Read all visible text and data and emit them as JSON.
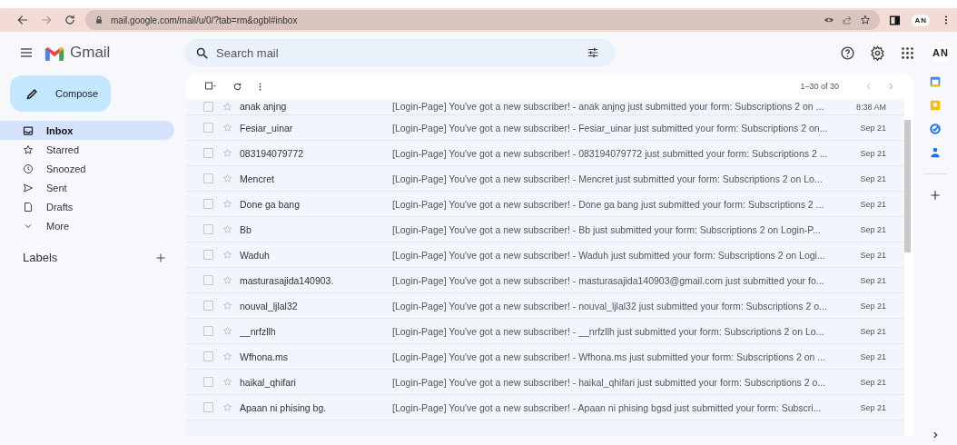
{
  "browser": {
    "url": "mail.google.com/mail/u/0/?tab=rm&ogbl#inbox",
    "profile": "AN"
  },
  "app": {
    "name": "Gmail",
    "search_placeholder": "Search mail",
    "account": "AN"
  },
  "compose": "Compose",
  "nav": [
    {
      "label": "Inbox",
      "kind": "inbox",
      "selected": true
    },
    {
      "label": "Starred",
      "kind": "star",
      "selected": false
    },
    {
      "label": "Snoozed",
      "kind": "clock",
      "selected": false
    },
    {
      "label": "Sent",
      "kind": "send",
      "selected": false
    },
    {
      "label": "Drafts",
      "kind": "file",
      "selected": false
    },
    {
      "label": "More",
      "kind": "chevron",
      "selected": false
    }
  ],
  "labels_heading": "Labels",
  "pagination": "1–30 of 30",
  "emails": [
    {
      "sender": "anak anjng",
      "text": "[Login-Page] You've got a new subscriber! - anak anjng just submitted your form: Subscriptions 2 on ...",
      "date": "8:38 AM",
      "checked": false,
      "starred": false
    },
    {
      "sender": "Fesiar_uinar",
      "text": "[Login-Page] You've got a new subscriber! - Fesiar_uinar just submitted your form: Subscriptions 2 on...",
      "date": "Sep 21",
      "checked": false,
      "starred": false
    },
    {
      "sender": "083194079772",
      "text": "[Login-Page] You've got a new subscriber! - 083194079772 just submitted your form: Subscriptions 2 ...",
      "date": "Sep 21",
      "checked": false,
      "starred": false
    },
    {
      "sender": "Mencret",
      "text": "[Login-Page] You've got a new subscriber! - Mencret just submitted your form: Subscriptions 2 on Lo...",
      "date": "Sep 21",
      "checked": false,
      "starred": false
    },
    {
      "sender": "Done ga bang",
      "text": "[Login-Page] You've got a new subscriber! - Done ga bang just submitted your form: Subscriptions 2 ...",
      "date": "Sep 21",
      "checked": false,
      "starred": false
    },
    {
      "sender": "Bb",
      "text": "[Login-Page] You've got a new subscriber! - Bb just submitted your form: Subscriptions 2 on Login-P...",
      "date": "Sep 21",
      "checked": false,
      "starred": false
    },
    {
      "sender": "Waduh",
      "text": "[Login-Page] You've got a new subscriber! - Waduh just submitted your form: Subscriptions 2 on Logi...",
      "date": "Sep 21",
      "checked": false,
      "starred": false
    },
    {
      "sender": "masturasajida140903.",
      "text": "[Login-Page] You've got a new subscriber! - masturasajida140903@gmail.com just submitted your fo...",
      "date": "Sep 21",
      "checked": false,
      "starred": false
    },
    {
      "sender": "nouval_ljlal32",
      "text": "[Login-Page] You've got a new subscriber! - nouval_ljlal32 just submitted your form: Subscriptions 2 o...",
      "date": "Sep 21",
      "checked": false,
      "starred": false
    },
    {
      "sender": "__nrfzllh",
      "text": "[Login-Page] You've got a new subscriber! - __nrfzllh just submitted your form: Subscriptions 2 on Lo...",
      "date": "Sep 21",
      "checked": false,
      "starred": false
    },
    {
      "sender": "Wfhona.ms",
      "text": "[Login-Page] You've got a new subscriber! - Wfhona.ms just submitted your form: Subscriptions 2 on ...",
      "date": "Sep 21",
      "checked": false,
      "starred": false
    },
    {
      "sender": "haikal_qhifari",
      "text": "[Login-Page] You've got a new subscriber! - haikal_qhifari just submitted your form: Subscriptions 2 o...",
      "date": "Sep 21",
      "checked": false,
      "starred": false
    },
    {
      "sender": "Apaan ni phising bg.",
      "text": "[Login-Page] You've got a new subscriber! - Apaan ni phising bgsd just submitted your form: Subscri...",
      "date": "Sep 21",
      "checked": false,
      "starred": false
    }
  ]
}
